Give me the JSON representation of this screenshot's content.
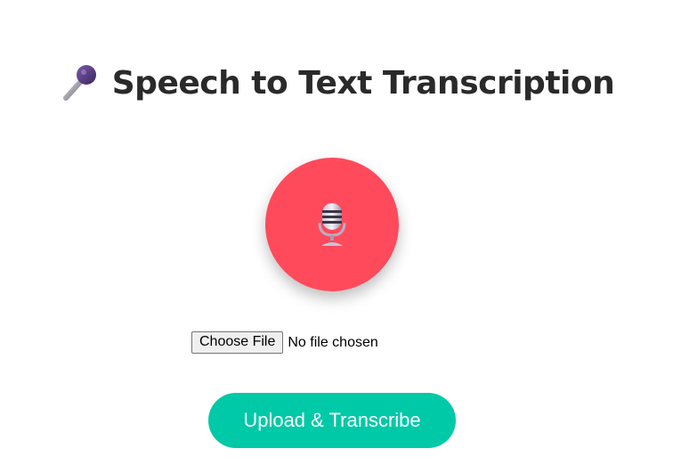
{
  "header": {
    "title": "Speech to Text Transcription",
    "icon": "microphone-icon"
  },
  "recorder": {
    "icon": "studio-microphone-icon",
    "color": "#ff4a5c"
  },
  "file_input": {
    "button_label": "Choose File",
    "status": "No file chosen"
  },
  "upload": {
    "label": "Upload & Transcribe",
    "color": "#00c9a7"
  }
}
